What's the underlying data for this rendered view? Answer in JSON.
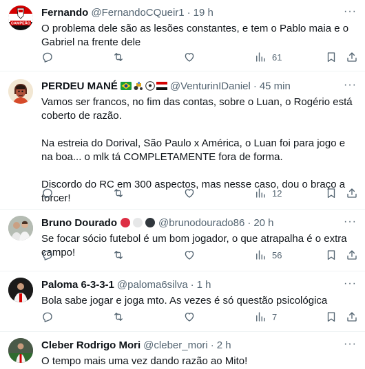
{
  "tweets": [
    {
      "name": "Fernando",
      "handle": "@FernandoCQueir1",
      "time": "19 h",
      "text": "O problema dele são as lesões constantes, e tem o Pablo maia e o Gabriel na frente dele",
      "views": "61",
      "avatar_text": "CAMPEÃO"
    },
    {
      "name": "PERDEU MANÉ",
      "handle": "@VenturinIDaniel",
      "time": "45 min",
      "text": "Vamos ser francos, no fim das contas, sobre o Luan, o Rogério está coberto de razão.\n\nNa estreia do Dorival, São Paulo x América, o Luan foi para jogo e na boa... o mlk tá COMPLETAMENTE fora de forma.\n\nDiscordo do RC em 300 aspectos, mas nesse caso, dou o braço a torcer!",
      "views": "12"
    },
    {
      "name": "Bruno Dourado",
      "handle": "@brunodourado86",
      "time": "20 h",
      "text": "Se focar sócio futebol é um bom jogador, o que atrapalha é o extra campo!",
      "views": "56"
    },
    {
      "name": "Paloma 6-3-3-1",
      "handle": "@paloma6silva",
      "time": "1 h",
      "text": "Bola sabe jogar e joga mto. As vezes é só questão psicológica",
      "views": "7"
    },
    {
      "name": "Cleber Rodrigo Mori",
      "handle": "@cleber_mori",
      "time": "2 h",
      "text": "O tempo mais uma vez dando razão ao Mito!"
    }
  ],
  "separator": "·",
  "more_label": "···",
  "colors": {
    "text": "#0f1419",
    "muted": "#536471",
    "divider": "#eff3f4",
    "spfc_red": "#e00000"
  }
}
